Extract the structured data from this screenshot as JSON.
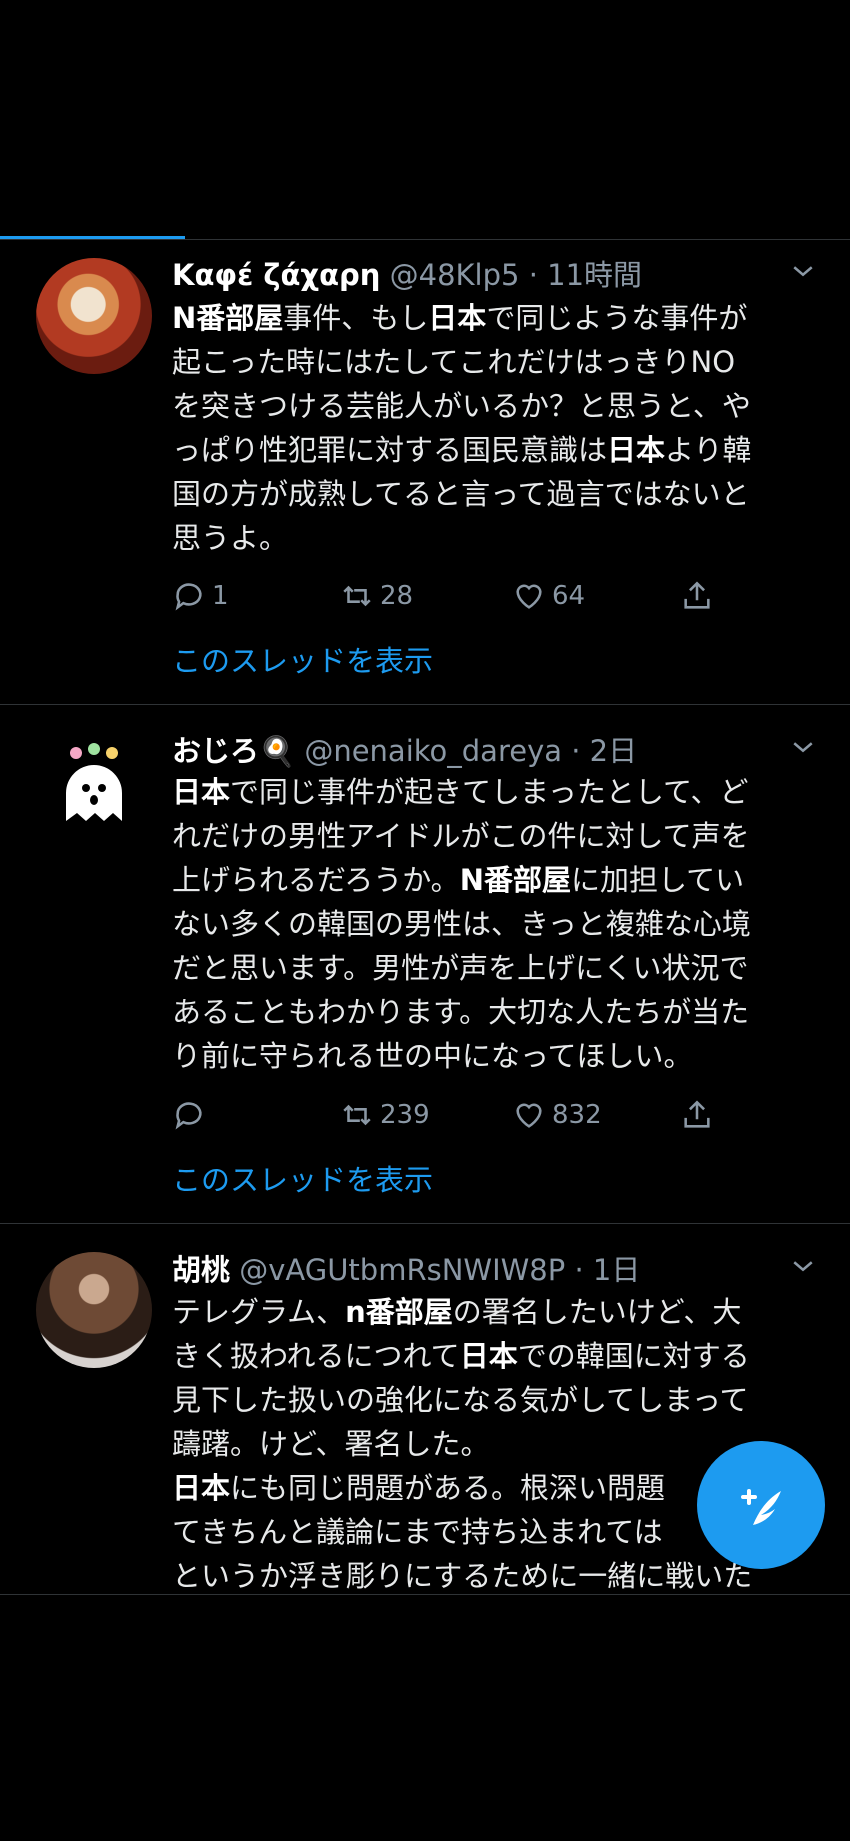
{
  "tweets": [
    {
      "name": "Καφέ ζάχαρη",
      "handle": "@48Klp5",
      "time": "11時間",
      "lines": [
        [
          {
            "t": "N番部屋",
            "b": true
          },
          {
            "t": "事件、もし"
          },
          {
            "t": "日本",
            "b": true
          },
          {
            "t": "で同じような事件が"
          }
        ],
        [
          {
            "t": "起こった時にはたしてこれだけはっきりNO"
          }
        ],
        [
          {
            "t": "を突きつける芸能人がいるか？と思うと、や"
          }
        ],
        [
          {
            "t": "っぱり性犯罪に対する国民意識は"
          },
          {
            "t": "日本",
            "b": true
          },
          {
            "t": "より韓"
          }
        ],
        [
          {
            "t": "国の方が成熟してると言って過言ではないと"
          }
        ],
        [
          {
            "t": "思うよ。"
          }
        ]
      ],
      "replies": "1",
      "retweets": "28",
      "likes": "64",
      "thread": "このスレッドを表示"
    },
    {
      "name": "おじろ🍳",
      "handle": "@nenaiko_dareya",
      "time": "2日",
      "lines": [
        [
          {
            "t": "日本",
            "b": true
          },
          {
            "t": "で同じ事件が起きてしまったとして、ど"
          }
        ],
        [
          {
            "t": "れだけの男性アイドルがこの件に対して声を"
          }
        ],
        [
          {
            "t": "上げられるだろうか。"
          },
          {
            "t": "N番部屋",
            "b": true
          },
          {
            "t": "に加担してい"
          }
        ],
        [
          {
            "t": "ない多くの韓国の男性は、きっと複雑な心境"
          }
        ],
        [
          {
            "t": "だと思います。男性が声を上げにくい状況で"
          }
        ],
        [
          {
            "t": "あることもわかります。大切な人たちが当た"
          }
        ],
        [
          {
            "t": "り前に守られる世の中になってほしい。"
          }
        ]
      ],
      "replies": "",
      "retweets": "239",
      "likes": "832",
      "thread": "このスレッドを表示"
    },
    {
      "name": "胡桃",
      "handle": "@vAGUtbmRsNWIW8P",
      "time": "1日",
      "lines": [
        [
          {
            "t": "テレグラム、"
          },
          {
            "t": "n番部屋",
            "b": true
          },
          {
            "t": "の署名したいけど、大"
          }
        ],
        [
          {
            "t": "きく扱われるにつれて"
          },
          {
            "t": "日本",
            "b": true
          },
          {
            "t": "での韓国に対する"
          }
        ],
        [
          {
            "t": "見下した扱いの強化になる気がしてしまって"
          }
        ],
        [
          {
            "t": "躊躇。けど、署名した。"
          }
        ],
        [
          {
            "t": "日本",
            "b": true
          },
          {
            "t": "にも同じ問題がある。根深い問題"
          }
        ],
        [
          {
            "t": "てきちんと議論にまで持ち込まれては"
          }
        ],
        [
          {
            "t": "というか浮き彫りにするために一緒に戦いた"
          }
        ]
      ]
    }
  ],
  "icons": {
    "reply": "reply-icon",
    "retweet": "retweet-icon",
    "like": "heart-icon",
    "share": "share-icon",
    "chevron": "chevron-down-icon",
    "compose": "compose-tweet-icon"
  },
  "colors": {
    "accent": "#1d9bf0",
    "muted": "#8b98a5",
    "bg": "#000000"
  }
}
